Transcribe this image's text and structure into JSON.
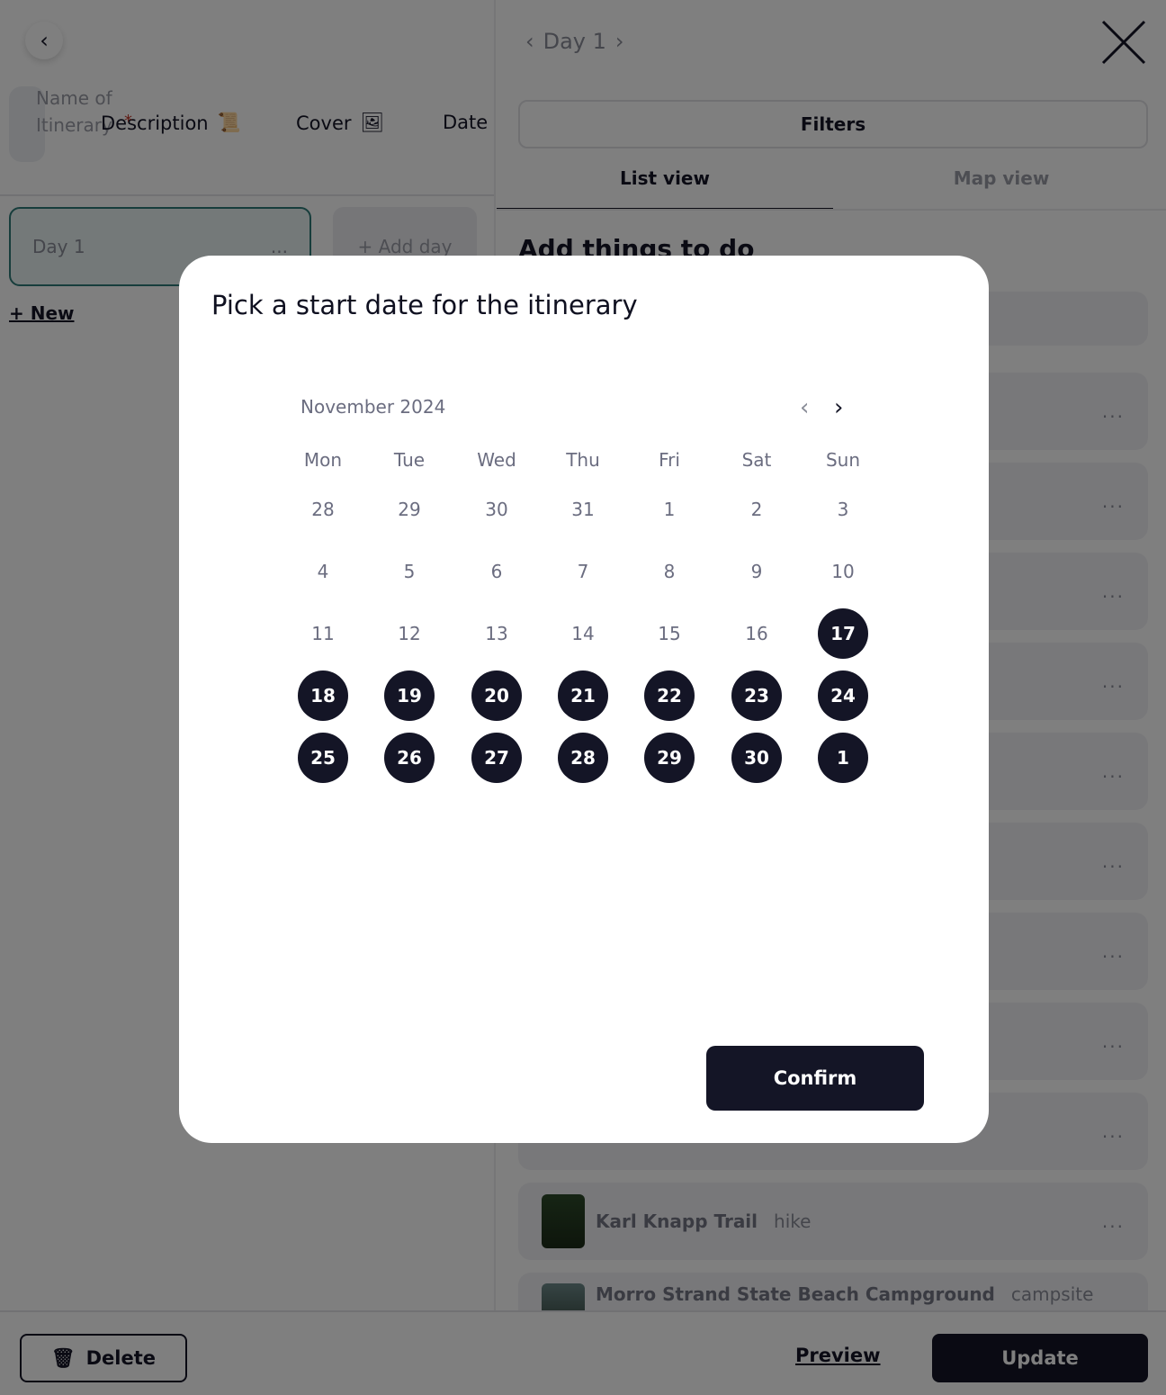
{
  "left": {
    "name_placeholder": "Name of Itinerary",
    "tabs": {
      "description": "Description",
      "cover": "Cover",
      "date": "Date"
    },
    "required_mark": "*",
    "day_card": "Day 1",
    "add_day": "+ Add day",
    "new_link": "+ New",
    "more": "..."
  },
  "right": {
    "day_nav": {
      "prev": "‹",
      "label": "Day 1",
      "next": "›"
    },
    "filters": "Filters",
    "views": [
      "List view",
      "Map view"
    ],
    "heading": "Add things to do",
    "cards": [
      {
        "title": "Karl Knapp Trail",
        "type": "hike"
      },
      {
        "title": "Morro Strand State Beach Campground",
        "type": "campsite"
      }
    ],
    "more": "..."
  },
  "footer": {
    "delete": "Delete",
    "preview": "Preview",
    "update": "Update"
  },
  "modal": {
    "title": "Pick a start date for the itinerary",
    "month": "November 2024",
    "weekdays": [
      "Mon",
      "Tue",
      "Wed",
      "Thu",
      "Fri",
      "Sat",
      "Sun"
    ],
    "weeks": [
      [
        "28",
        "29",
        "30",
        "31",
        "1",
        "2",
        "3"
      ],
      [
        "4",
        "5",
        "6",
        "7",
        "8",
        "9",
        "10"
      ],
      [
        "11",
        "12",
        "13",
        "14",
        "15",
        "16",
        "17"
      ],
      [
        "18",
        "19",
        "20",
        "21",
        "22",
        "23",
        "24"
      ],
      [
        "25",
        "26",
        "27",
        "28",
        "29",
        "30",
        "1"
      ]
    ],
    "selectable_from": "17",
    "confirm": "Confirm"
  },
  "colors": {
    "primary": "#141526",
    "day_border": "#2f7b78",
    "required": "#c0392b"
  }
}
